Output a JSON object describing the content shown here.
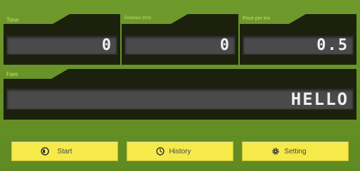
{
  "panels": {
    "time": {
      "label": "Time",
      "value": "0"
    },
    "distance": {
      "label": "Distance (Km)",
      "value": "0"
    },
    "price": {
      "label": "Price per km",
      "value": "0.5"
    },
    "fare": {
      "label": "Fare",
      "value": "HELLO"
    }
  },
  "buttons": {
    "start": {
      "label": "Start",
      "icon": "record-icon"
    },
    "history": {
      "label": "History",
      "icon": "history-icon"
    },
    "setting": {
      "label": "Setting",
      "icon": "gear-icon"
    }
  },
  "colors": {
    "background": "#6a9428",
    "panel": "#1c210d",
    "lcd": "#4a4a4a",
    "digits": "#eef0f0",
    "button": "#f5ea4a",
    "label": "#c8e06a"
  }
}
